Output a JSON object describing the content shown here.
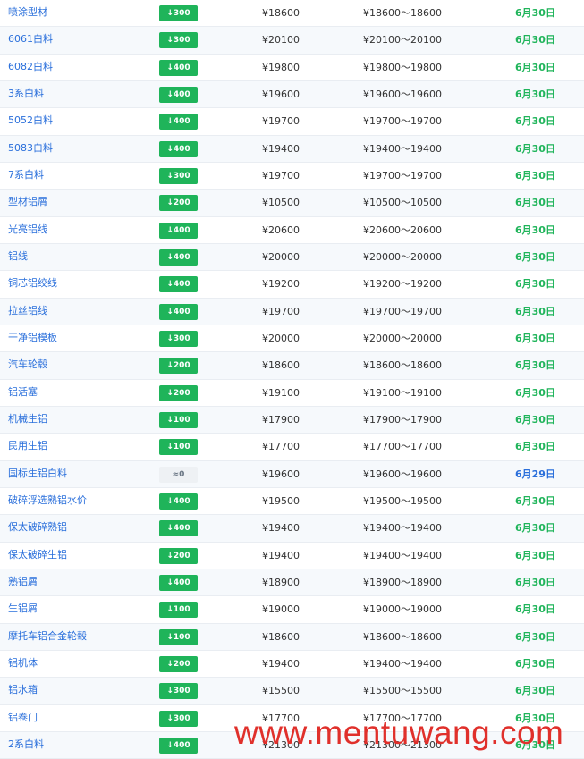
{
  "rows": [
    {
      "name": "喷涂型材",
      "change": "↓300",
      "price": "¥18600",
      "range": "¥18600～18600",
      "date": "6月30日",
      "trend": "down",
      "date_color": "#1fb45a"
    },
    {
      "name": "6061白料",
      "change": "↓300",
      "price": "¥20100",
      "range": "¥20100～20100",
      "date": "6月30日",
      "trend": "down",
      "date_color": "#1fb45a"
    },
    {
      "name": "6082白料",
      "change": "↓400",
      "price": "¥19800",
      "range": "¥19800～19800",
      "date": "6月30日",
      "trend": "down",
      "date_color": "#1fb45a"
    },
    {
      "name": "3系白料",
      "change": "↓400",
      "price": "¥19600",
      "range": "¥19600～19600",
      "date": "6月30日",
      "trend": "down",
      "date_color": "#1fb45a"
    },
    {
      "name": "5052白料",
      "change": "↓400",
      "price": "¥19700",
      "range": "¥19700～19700",
      "date": "6月30日",
      "trend": "down",
      "date_color": "#1fb45a"
    },
    {
      "name": "5083白料",
      "change": "↓400",
      "price": "¥19400",
      "range": "¥19400～19400",
      "date": "6月30日",
      "trend": "down",
      "date_color": "#1fb45a"
    },
    {
      "name": "7系白料",
      "change": "↓300",
      "price": "¥19700",
      "range": "¥19700～19700",
      "date": "6月30日",
      "trend": "down",
      "date_color": "#1fb45a"
    },
    {
      "name": "型材铝屑",
      "change": "↓200",
      "price": "¥10500",
      "range": "¥10500～10500",
      "date": "6月30日",
      "trend": "down",
      "date_color": "#1fb45a"
    },
    {
      "name": "光亮铝线",
      "change": "↓400",
      "price": "¥20600",
      "range": "¥20600～20600",
      "date": "6月30日",
      "trend": "down",
      "date_color": "#1fb45a"
    },
    {
      "name": "铝线",
      "change": "↓400",
      "price": "¥20000",
      "range": "¥20000～20000",
      "date": "6月30日",
      "trend": "down",
      "date_color": "#1fb45a"
    },
    {
      "name": "铜芯铝绞线",
      "change": "↓400",
      "price": "¥19200",
      "range": "¥19200～19200",
      "date": "6月30日",
      "trend": "down",
      "date_color": "#1fb45a"
    },
    {
      "name": "拉丝铝线",
      "change": "↓400",
      "price": "¥19700",
      "range": "¥19700～19700",
      "date": "6月30日",
      "trend": "down",
      "date_color": "#1fb45a"
    },
    {
      "name": "干净铝模板",
      "change": "↓300",
      "price": "¥20000",
      "range": "¥20000～20000",
      "date": "6月30日",
      "trend": "down",
      "date_color": "#1fb45a"
    },
    {
      "name": "汽车轮毂",
      "change": "↓200",
      "price": "¥18600",
      "range": "¥18600～18600",
      "date": "6月30日",
      "trend": "down",
      "date_color": "#1fb45a"
    },
    {
      "name": "铝活塞",
      "change": "↓200",
      "price": "¥19100",
      "range": "¥19100～19100",
      "date": "6月30日",
      "trend": "down",
      "date_color": "#1fb45a"
    },
    {
      "name": "机械生铝",
      "change": "↓100",
      "price": "¥17900",
      "range": "¥17900～17900",
      "date": "6月30日",
      "trend": "down",
      "date_color": "#1fb45a"
    },
    {
      "name": "民用生铝",
      "change": "↓100",
      "price": "¥17700",
      "range": "¥17700～17700",
      "date": "6月30日",
      "trend": "down",
      "date_color": "#1fb45a"
    },
    {
      "name": "国标生铝白料",
      "change": "≈0",
      "price": "¥19600",
      "range": "¥19600～19600",
      "date": "6月29日",
      "trend": "flat",
      "date_color": "#2a6fdb"
    },
    {
      "name": "破碎浮选熟铝水价",
      "change": "↓400",
      "price": "¥19500",
      "range": "¥19500～19500",
      "date": "6月30日",
      "trend": "down",
      "date_color": "#1fb45a"
    },
    {
      "name": "保太破碎熟铝",
      "change": "↓400",
      "price": "¥19400",
      "range": "¥19400～19400",
      "date": "6月30日",
      "trend": "down",
      "date_color": "#1fb45a"
    },
    {
      "name": "保太破碎生铝",
      "change": "↓200",
      "price": "¥19400",
      "range": "¥19400～19400",
      "date": "6月30日",
      "trend": "down",
      "date_color": "#1fb45a"
    },
    {
      "name": "熟铝屑",
      "change": "↓400",
      "price": "¥18900",
      "range": "¥18900～18900",
      "date": "6月30日",
      "trend": "down",
      "date_color": "#1fb45a"
    },
    {
      "name": "生铝屑",
      "change": "↓100",
      "price": "¥19000",
      "range": "¥19000～19000",
      "date": "6月30日",
      "trend": "down",
      "date_color": "#1fb45a"
    },
    {
      "name": "摩托车铝合金轮毂",
      "change": "↓100",
      "price": "¥18600",
      "range": "¥18600～18600",
      "date": "6月30日",
      "trend": "down",
      "date_color": "#1fb45a"
    },
    {
      "name": "铝机体",
      "change": "↓200",
      "price": "¥19400",
      "range": "¥19400～19400",
      "date": "6月30日",
      "trend": "down",
      "date_color": "#1fb45a"
    },
    {
      "name": "铝水箱",
      "change": "↓300",
      "price": "¥15500",
      "range": "¥15500～15500",
      "date": "6月30日",
      "trend": "down",
      "date_color": "#1fb45a"
    },
    {
      "name": "铝卷门",
      "change": "↓300",
      "price": "¥17700",
      "range": "¥17700～17700",
      "date": "6月30日",
      "trend": "down",
      "date_color": "#1fb45a"
    },
    {
      "name": "2系白料",
      "change": "↓400",
      "price": "¥21300",
      "range": "¥21300～21300",
      "date": "6月30日",
      "trend": "down",
      "date_color": "#1fb45a"
    }
  ],
  "watermark": "www.mentuwang.com",
  "colors": {
    "down_badge": "#1fb45a",
    "flat_badge": "#eef1f4",
    "name_link": "#2a6fdb",
    "watermark": "#e0302b"
  }
}
